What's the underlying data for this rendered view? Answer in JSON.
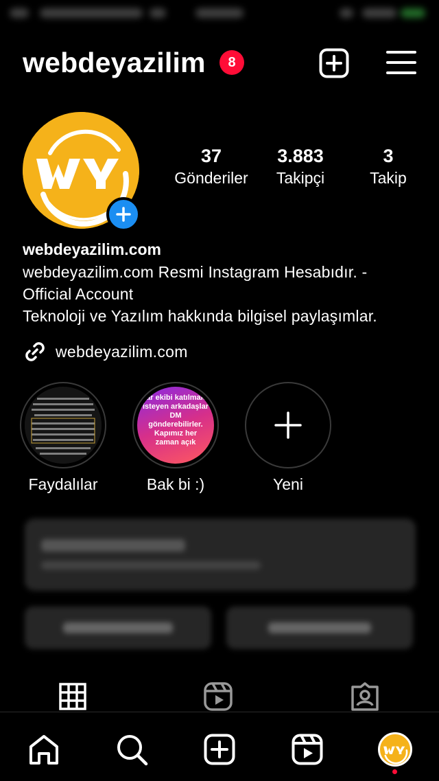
{
  "header": {
    "username": "webdeyazilim",
    "notification_count": "8"
  },
  "stats": [
    {
      "value": "37",
      "label": "Gönderiler"
    },
    {
      "value": "3.883",
      "label": "Takipçi"
    },
    {
      "value": "3",
      "label": "Takip"
    }
  ],
  "bio": {
    "name": "webdeyazilim.com",
    "lines": [
      "webdeyazilim.com Resmi Instagram Hesabıdır. -",
      "Official Account",
      "Teknoloji ve Yazılım hakkında bilgisel paylaşımlar."
    ],
    "link": "webdeyazilim.com"
  },
  "highlights": [
    {
      "label": "Faydalılar"
    },
    {
      "label": "Bak bi :)",
      "preview_text": "ar ekibi katılmak isteyen arkadaşlar DM gönderebilirler. Kapımız her zaman açık"
    },
    {
      "label": "Yeni"
    }
  ],
  "colors": {
    "background": "#000000",
    "badge": "#ff0d37",
    "brand_yellow": "#f5b21a",
    "add_blue": "#1b8ef2"
  },
  "icons": {
    "header": [
      "new-post-icon",
      "menu-icon"
    ],
    "profile_tabs": [
      "grid-icon",
      "reels-icon",
      "tagged-icon"
    ],
    "bottom_nav": [
      "home-icon",
      "search-icon",
      "create-icon",
      "reels-icon",
      "profile-avatar"
    ]
  }
}
